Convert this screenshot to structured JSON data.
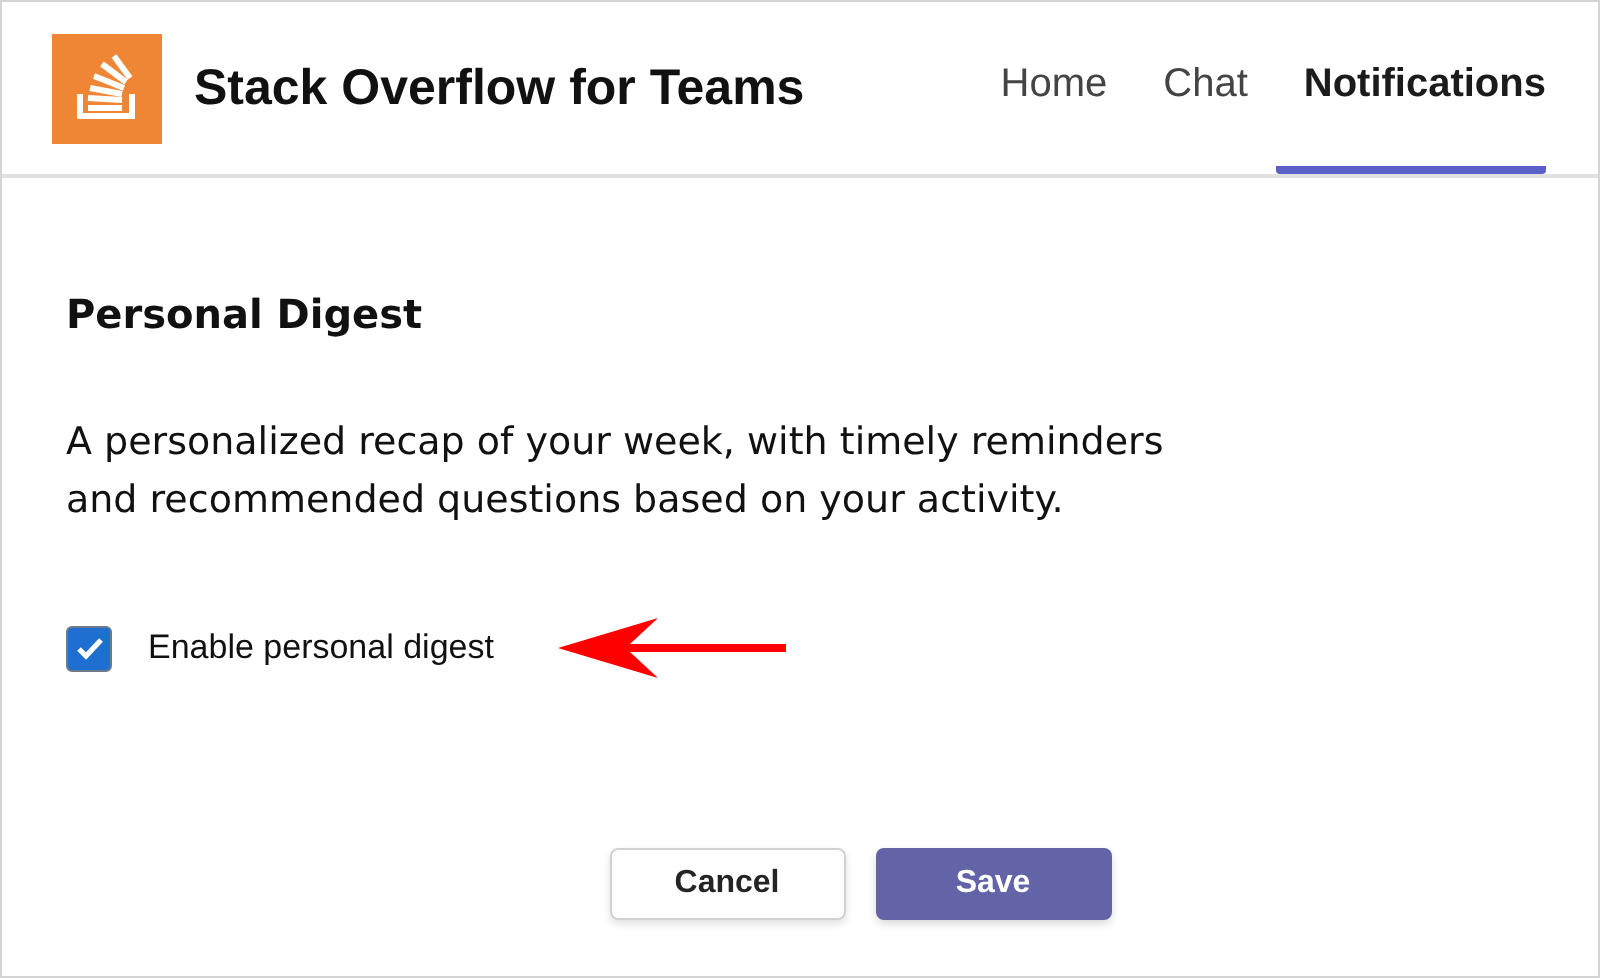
{
  "header": {
    "app_title": "Stack Overflow for Teams",
    "tabs": [
      {
        "label": "Home",
        "selected": false
      },
      {
        "label": "Chat",
        "selected": false
      },
      {
        "label": "Notifications",
        "selected": true
      }
    ]
  },
  "section": {
    "title": "Personal Digest",
    "description": "A personalized recap of your week, with timely reminders and recommended questions based on your activity.",
    "option": {
      "label": "Enable personal digest",
      "checked": true
    }
  },
  "buttons": [
    {
      "label": "Cancel",
      "kind": "secondary"
    },
    {
      "label": "Save",
      "kind": "primary"
    }
  ]
}
